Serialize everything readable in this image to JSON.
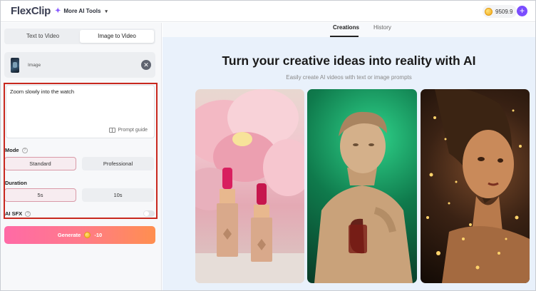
{
  "app": {
    "logo": "FlexClip"
  },
  "topbar": {
    "more_tools": "More AI Tools",
    "credits": "9509.9"
  },
  "left": {
    "tabs": [
      "Text to Video",
      "Image to Video"
    ],
    "image_label": "Image",
    "prompt_text": "Zoom slowly into the watch",
    "prompt_guide": "Prompt guide",
    "mode_label": "Mode",
    "mode_options": [
      "Standard",
      "Professional"
    ],
    "duration_label": "Duration",
    "duration_options": [
      "5s",
      "10s"
    ],
    "sfx_label": "AI SFX",
    "generate_label": "Generate",
    "generate_cost": "-10"
  },
  "right": {
    "tabs": [
      "Creations",
      "History"
    ],
    "title": "Turn your creative ideas into reality with AI",
    "subtitle": "Easily create AI videos with text or image prompts"
  },
  "colors": {
    "accent": "#7b4dff",
    "highlight": "#c8281e",
    "generate_start": "#ff6aa6",
    "generate_end": "#ff8f4f"
  }
}
